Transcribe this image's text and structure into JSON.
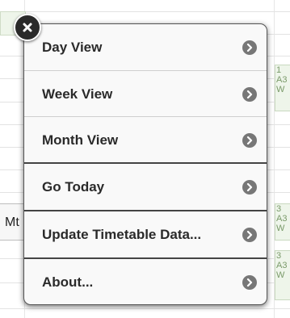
{
  "background": {
    "side_label": "Mt",
    "cells": [
      "1\nA3\nW",
      "3\nA3\nW",
      "3\nA3\nW"
    ]
  },
  "menu": {
    "items": [
      {
        "label": "Day View",
        "icon": "chevron-right-icon"
      },
      {
        "label": "Week View",
        "icon": "chevron-right-icon"
      },
      {
        "label": "Month View",
        "icon": "chevron-right-icon"
      },
      {
        "label": "Go Today",
        "icon": "chevron-right-icon"
      },
      {
        "label": "Update Timetable Data...",
        "icon": "chevron-right-icon"
      },
      {
        "label": "About...",
        "icon": "chevron-right-icon"
      }
    ],
    "close_icon": "close-icon"
  },
  "colors": {
    "menu_bg": "#f9f9f9",
    "chevron": "#777777",
    "close_bg": "#2a2a2a",
    "cell_bg": "#eef5ea"
  }
}
